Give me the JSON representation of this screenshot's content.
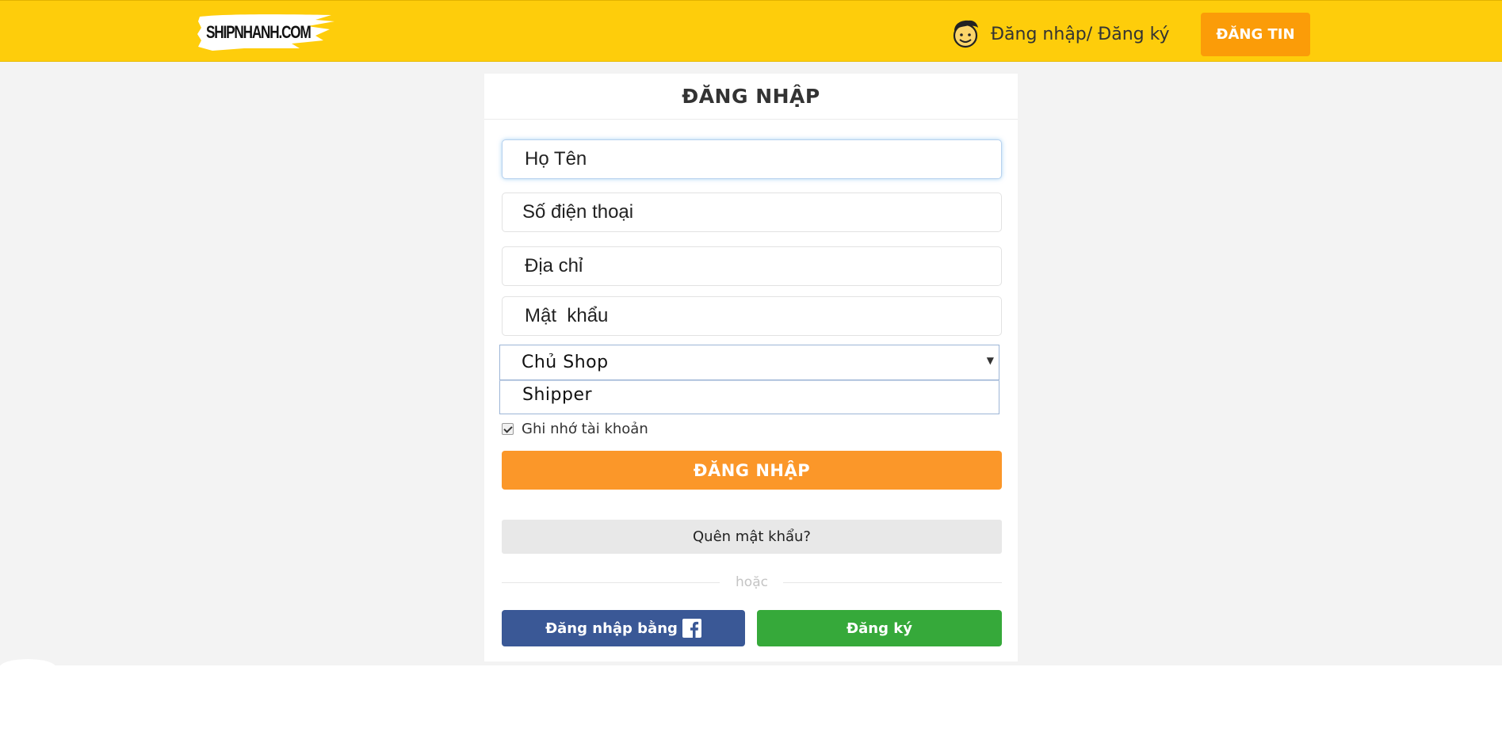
{
  "header": {
    "logo_text": "SHIPNHANH.COM",
    "login_register_link": "Đăng nhập/ Đăng ký",
    "post_button": "ĐĂNG TIN",
    "avatar_icon": "smiley-face-icon"
  },
  "login_form": {
    "title": "ĐĂNG NHẬP",
    "name_placeholder": "Họ Tên",
    "phone_placeholder": "Số điện thoại",
    "address_placeholder": "Địa chỉ",
    "password_placeholder": "Mật  khẩu",
    "role_select": {
      "selected": "Chủ Shop",
      "options": [
        "Chủ Shop",
        "Shipper"
      ],
      "highlighted_option": "Shipper"
    },
    "remember_label": "Ghi nhớ tài khoản",
    "remember_checked": true,
    "submit_button": "ĐĂNG NHẬP",
    "forgot_button": "Quên mật khẩu?",
    "divider_text": "hoặc",
    "facebook_button": "Đăng nhập bằng",
    "register_button": "Đăng ký"
  },
  "colors": {
    "header_bg": "#fecd0b",
    "post_button_bg": "#fb9c08",
    "submit_bg": "#fb9729",
    "facebook_bg": "#3a5896",
    "register_bg": "#36a93a",
    "page_bg": "#f3f3f3"
  }
}
